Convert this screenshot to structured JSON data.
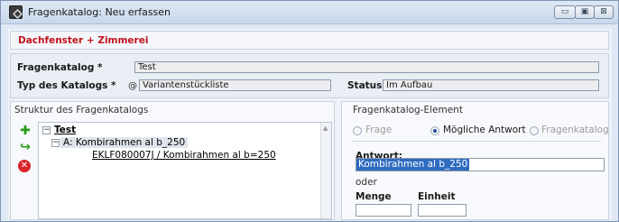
{
  "window": {
    "title": "Fragenkatalog: Neu erfassen",
    "controls": {
      "minimize": "▭",
      "maximize": "▣",
      "close": "⊠"
    }
  },
  "banner": {
    "text": "Dachfenster + Zimmerei"
  },
  "header": {
    "fragenkatalog_label": "Fragenkatalog *",
    "fragenkatalog_value": "Test",
    "typ_label": "Typ des Katalogs *",
    "typ_at": "@",
    "typ_value": "Variantenstückliste",
    "status_label": "Status",
    "status_value": "Im Aufbau"
  },
  "structure": {
    "title": "Struktur des Fragenkatalogs",
    "tree": {
      "root": "Test",
      "child": "A: Kombirahmen al b_250",
      "leaf": "EKLF080007J / Kombirahmen al b=250"
    }
  },
  "element": {
    "title": "Fragenkatalog-Element",
    "radios": [
      {
        "label": "Frage",
        "checked": false
      },
      {
        "label": "Mögliche Antwort",
        "checked": true
      },
      {
        "label": "Fragenkatalog",
        "checked": false
      }
    ],
    "antwort_label": "Antwort:",
    "antwort_value": "Kombirahmen al b_250",
    "oder_label": "oder",
    "menge_label": "Menge",
    "einheit_label": "Einheit"
  },
  "colors": {
    "banner_text": "#c0141c",
    "selection": "#2f6bbf"
  },
  "icons": [
    "app-icon",
    "add-icon",
    "move-icon",
    "delete-icon"
  ]
}
